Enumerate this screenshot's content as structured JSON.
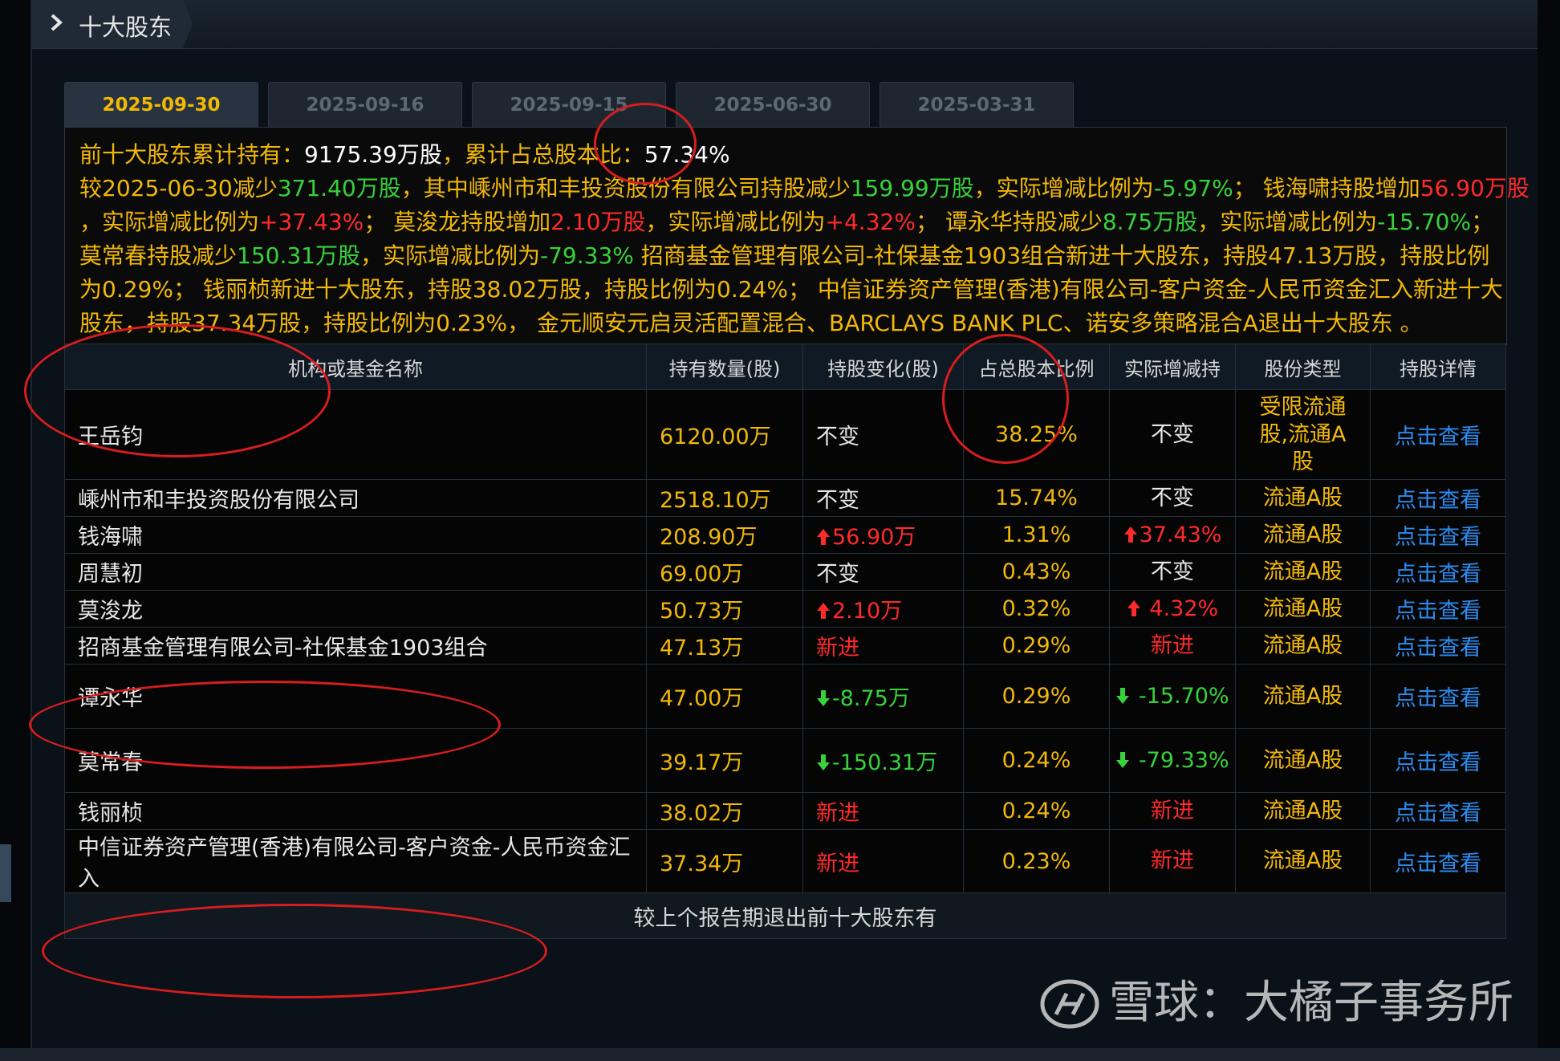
{
  "header": {
    "title": "十大股东"
  },
  "tabs": [
    "2025-09-30",
    "2025-09-16",
    "2025-09-15",
    "2025-06-30",
    "2025-03-31"
  ],
  "summary": {
    "l1_label": "前十大股东累计持有：",
    "l1_shares": "9175.39万股",
    "l1_sep": "，累计占总股本比：",
    "l1_pct": "57.34%",
    "l2_a": "较2025-06-30减少",
    "l2_b": "371.40万股",
    "l2_c": "，其中嵊州市和丰投资股份有限公司持股减少",
    "l2_d": "159.99万股",
    "l2_e": "，实际增减比例为",
    "l2_f": "-5.97%",
    "l2_g": "；  钱海啸持股增加",
    "l2_h": "56.90万股",
    "l3_a": "，实际增减比例为",
    "l3_b": "+37.43%",
    "l3_c": "；  莫浚龙持股增加",
    "l3_d": "2.10万股",
    "l3_e": "，实际增减比例为",
    "l3_f": "+4.32%",
    "l3_g": "；  谭永华持股减少",
    "l3_h": "8.75万股",
    "l3_i": "，实际增减比例为",
    "l3_j": "-15.70%",
    "l3_k": "；",
    "l4_a": "莫常春持股减少",
    "l4_b": "150.31万股",
    "l4_c": "，实际增减比例为",
    "l4_d": "-79.33%",
    "l4_e": "  招商基金管理有限公司-社保基金1903组合新进十大股东，持股47.13万股，持股比例",
    "l5": "为0.29%；  钱丽桢新进十大股东，持股38.02万股，持股比例为0.24%；  中信证券资产管理(香港)有限公司-客户资金-人民币资金汇入新进十大",
    "l6": "股东，持股37.34万股，持股比例为0.23%，  金元顺安元启灵活配置混合、BARCLAYS BANK PLC、诺安多策略混合A退出十大股东 。"
  },
  "table": {
    "headers": [
      "机构或基金名称",
      "持有数量(股)",
      "持股变化(股)",
      "占总股本比例",
      "实际增减持",
      "股份类型",
      "持股详情"
    ],
    "rows": [
      {
        "name": "王岳钧",
        "qty": "6120.00万",
        "change": "不变",
        "change_dir": "same",
        "pct": "38.25%",
        "actual": "不变",
        "actual_dir": "same",
        "type": "受限流通股,流通A股",
        "detail": "点击查看"
      },
      {
        "name": "嵊州市和丰投资股份有限公司",
        "qty": "2518.10万",
        "change": "不变",
        "change_dir": "same",
        "pct": "15.74%",
        "actual": "不变",
        "actual_dir": "same",
        "type": "流通A股",
        "detail": "点击查看"
      },
      {
        "name": "钱海啸",
        "qty": "208.90万",
        "change": "56.90万",
        "change_dir": "up",
        "pct": "1.31%",
        "actual": "37.43%",
        "actual_dir": "up",
        "type": "流通A股",
        "detail": "点击查看"
      },
      {
        "name": "周慧初",
        "qty": "69.00万",
        "change": "不变",
        "change_dir": "same",
        "pct": "0.43%",
        "actual": "不变",
        "actual_dir": "same",
        "type": "流通A股",
        "detail": "点击查看"
      },
      {
        "name": "莫浚龙",
        "qty": "50.73万",
        "change": "2.10万",
        "change_dir": "up",
        "pct": "0.32%",
        "actual": " 4.32%",
        "actual_dir": "up",
        "type": "流通A股",
        "detail": "点击查看"
      },
      {
        "name": "招商基金管理有限公司-社保基金1903组合",
        "qty": "47.13万",
        "change": "新进",
        "change_dir": "new",
        "pct": "0.29%",
        "actual": "新进",
        "actual_dir": "new",
        "type": "流通A股",
        "detail": "点击查看"
      },
      {
        "name": "谭永华",
        "qty": "47.00万",
        "change": "-8.75万",
        "change_dir": "down",
        "pct": "0.29%",
        "actual": " -15.70%",
        "actual_dir": "down",
        "type": "流通A股",
        "detail": "点击查看"
      },
      {
        "name": "莫常春",
        "qty": "39.17万",
        "change": "-150.31万",
        "change_dir": "down",
        "pct": "0.24%",
        "actual": " -79.33%",
        "actual_dir": "down",
        "type": "流通A股",
        "detail": "点击查看"
      },
      {
        "name": "钱丽桢",
        "qty": "38.02万",
        "change": "新进",
        "change_dir": "new",
        "pct": "0.24%",
        "actual": "新进",
        "actual_dir": "new",
        "type": "流通A股",
        "detail": "点击查看"
      },
      {
        "name": "中信证券资产管理(香港)有限公司-客户资金-人民币资金汇入",
        "qty": "37.34万",
        "change": "新进",
        "change_dir": "new",
        "pct": "0.23%",
        "actual": "新进",
        "actual_dir": "new",
        "type": "流通A股",
        "detail": "点击查看"
      }
    ],
    "footer": "较上个报告期退出前十大股东有"
  },
  "watermark": {
    "brand": "雪球",
    "sep": "：",
    "author": "大橘子事务所"
  },
  "colors": {
    "accent": "#f2b807",
    "up": "#ff2a2a",
    "down": "#37d23b",
    "link": "#2d8cf0",
    "annotation": "#d71d1d"
  },
  "icons": [
    "chevron-right-icon",
    "arrow-up-icon",
    "arrow-down-icon",
    "xueqiu-logo-icon"
  ]
}
